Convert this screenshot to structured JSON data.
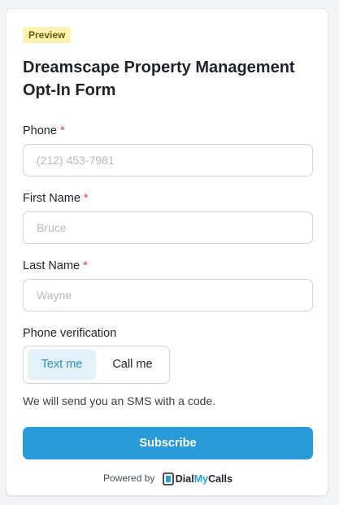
{
  "badge": {
    "label": "Preview"
  },
  "form": {
    "title": "Dreamscape Property Management Opt-In Form",
    "required_mark": "*",
    "fields": {
      "phone": {
        "label": "Phone",
        "placeholder": "(212) 453-7981",
        "value": ""
      },
      "first_name": {
        "label": "First Name",
        "placeholder": "Bruce",
        "value": ""
      },
      "last_name": {
        "label": "Last Name",
        "placeholder": "Wayne",
        "value": ""
      }
    },
    "verification": {
      "label": "Phone verification",
      "options": [
        "Text me",
        "Call me"
      ],
      "selected": "Text me",
      "hint": "We will send you an SMS with a code."
    },
    "submit_label": "Subscribe"
  },
  "footer": {
    "powered_by": "Powered by",
    "brand_parts": {
      "dial": "Dial",
      "my": "My",
      "calls": "Calls"
    },
    "brand_logo_icon": "dialmycalls-logo-icon"
  },
  "colors": {
    "accent": "#2a9ad9",
    "badge_bg": "#fef3b0",
    "required": "#e03e3e",
    "toggle_active_bg": "#e3f1fa"
  }
}
